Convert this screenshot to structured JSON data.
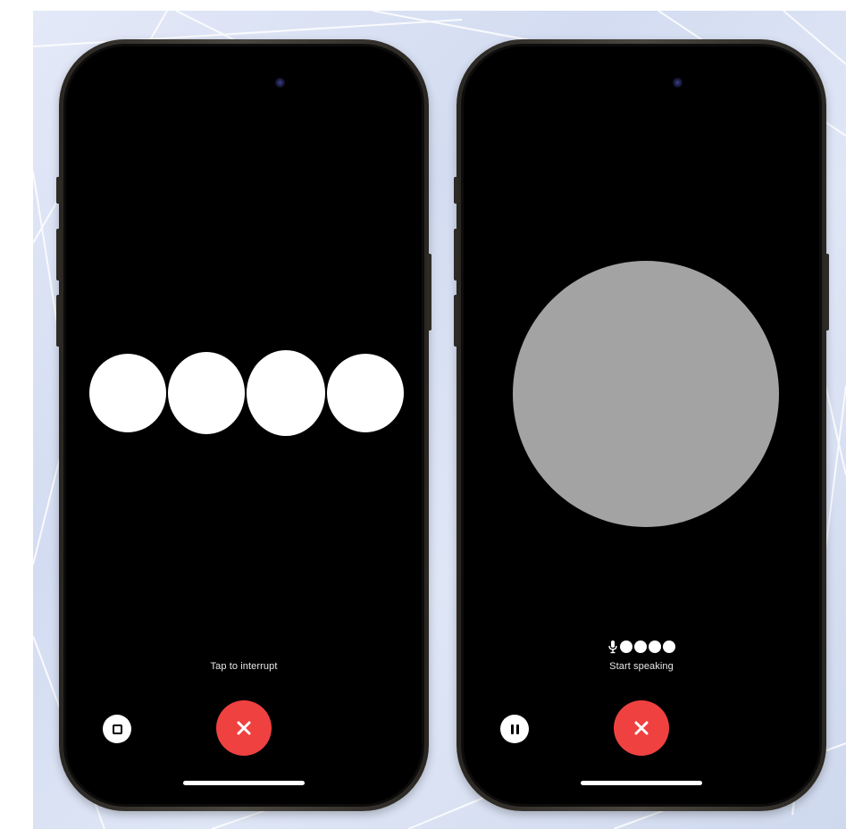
{
  "screens": [
    {
      "id": "responding",
      "caption": "Tap to interrupt",
      "visual": "four-white-dots",
      "control_icon": "stop-icon",
      "end_icon": "close-icon"
    },
    {
      "id": "listening",
      "caption": "Start speaking",
      "visual": "gray-orb",
      "level_indicator": {
        "icon": "microphone-icon",
        "dots": 4
      },
      "control_icon": "pause-icon",
      "end_icon": "close-icon"
    }
  ],
  "colors": {
    "screen": "#000000",
    "end_button": "#ef4140",
    "orb": "#a3a3a3",
    "dots": "#ffffff",
    "backdrop": "#d8e0f3"
  }
}
